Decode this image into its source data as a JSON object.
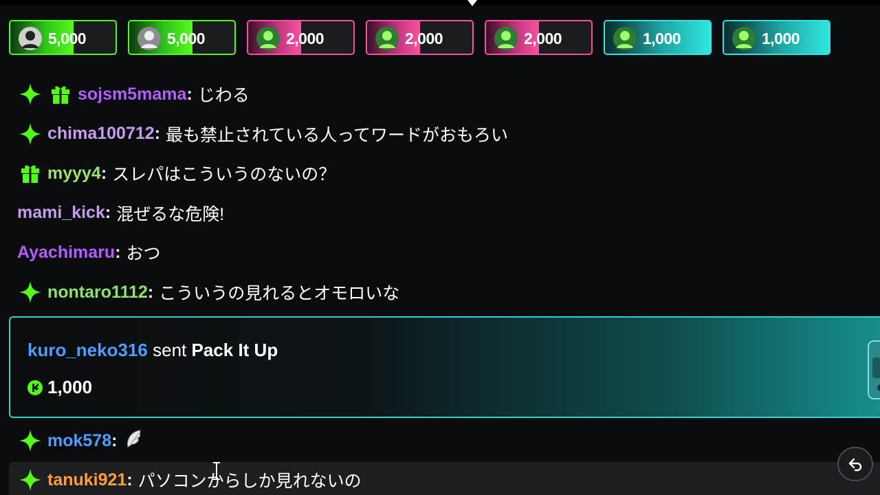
{
  "pinned_gifts": [
    {
      "amount": "5,000",
      "theme": "green",
      "avatar": "white-avatar"
    },
    {
      "amount": "5,000",
      "theme": "green",
      "avatar": "gray-avatar"
    },
    {
      "amount": "2,000",
      "theme": "pink",
      "avatar": "green-avatar"
    },
    {
      "amount": "2,000",
      "theme": "pink",
      "avatar": "green-avatar"
    },
    {
      "amount": "2,000",
      "theme": "pink",
      "avatar": "green-avatar"
    },
    {
      "amount": "1,000",
      "theme": "cyan",
      "avatar": "green-avatar"
    },
    {
      "amount": "1,000",
      "theme": "cyan",
      "avatar": "green-avatar"
    }
  ],
  "chat": [
    {
      "badges": [
        "sparkle-badge",
        "gift-badge"
      ],
      "user": "sojsm5mama",
      "user_color": "#b35cff",
      "message": "じわる"
    },
    {
      "badges": [
        "sparkle-badge"
      ],
      "user": "chima100712",
      "user_color": "#c79bf2",
      "message": "最も禁止されている人ってワードがおもろい"
    },
    {
      "badges": [
        "gift-badge"
      ],
      "user": "myyy4",
      "user_color": "#9be36b",
      "message": "スレパはこういうのないの？"
    },
    {
      "badges": [],
      "user": "mami_kick",
      "user_color": "#c79bf2",
      "message": "混ぜるな危険!"
    },
    {
      "badges": [],
      "user": "Ayachimaru",
      "user_color": "#b35cff",
      "message": "おつ"
    },
    {
      "badges": [
        "sparkle-badge"
      ],
      "user": "nontaro1112",
      "user_color": "#8fe36b",
      "message": "こういうの見れるとオモロいな"
    }
  ],
  "gift_event": {
    "sender": "kuro_neko316",
    "verb": "sent",
    "gift_name": "Pack It Up",
    "amount": "1,000"
  },
  "chat_after": [
    {
      "badges": [
        "sparkle-badge"
      ],
      "user": "mok578",
      "user_color": "#4f9dff",
      "message": "",
      "emote": "wing-emote"
    },
    {
      "badges": [
        "sparkle-badge"
      ],
      "user": "tanuki921",
      "user_color": "#ff9d3a",
      "message": "パソコンからしか見れないの"
    }
  ],
  "colors": {
    "green": "#53fc18",
    "pink": "#ff4fa3",
    "cyan": "#2fe6e0"
  }
}
